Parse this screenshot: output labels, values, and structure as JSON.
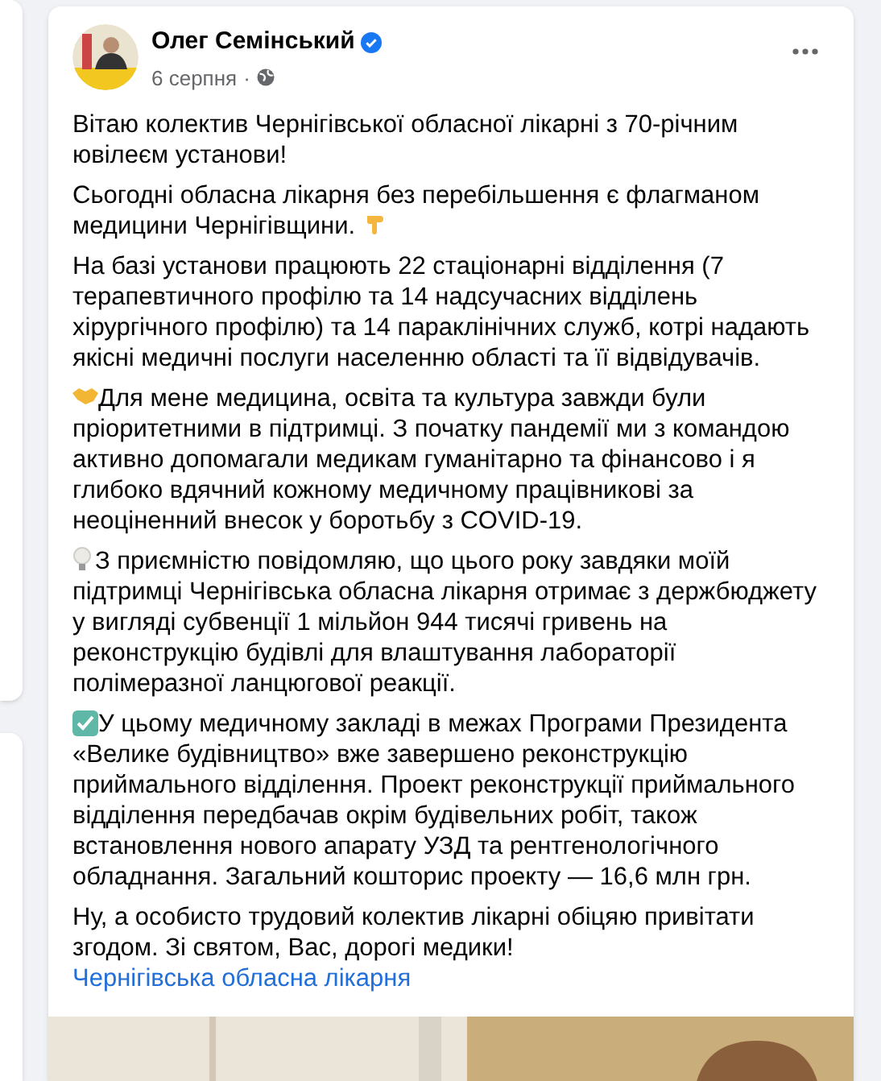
{
  "post": {
    "author": "Олег Семінський",
    "verified": true,
    "date": "6 серпня",
    "separator": "·",
    "paragraphs": [
      {
        "kind": "plain",
        "text": "Вітаю колектив Чернігівської обласної лікарні з 70-річним ювілеєм установи!"
      },
      {
        "text": "Сьогодні обласна лікарня без перебільшення є флагманом медицини Чернігівщини.",
        "kind": "pointing"
      },
      {
        "kind": "plain",
        "text": "На базі установи працюють 22 стаціонарні відділення (7 терапевтичного профілю та 14 надсучасних відділень хірургічного профілю) та 14 параклінічних служб, котрі надають якісні медичні послуги населенню області та її відвідувачів."
      },
      {
        "text": "Для мене медицина, освіта та культура завжди були пріоритетними в підтримці. З початку пандемії ми з командою активно допомагали медикам гуманітарно та фінансово і я глибоко вдячний кожному медичному працівникові за неоціненний внесок у боротьбу з COVID-19.",
        "kind": "handshake"
      },
      {
        "text": "З приємністю повідомляю, що цього року завдяки моїй підтримці Чернігівська обласна лікарня отримає з держбюджету у вигляді субвенції 1 мільйон 944 тисячі гривень на реконструкцію будівлі для влаштування лабораторії полімеразної ланцюгової реакції.",
        "kind": "bulb"
      },
      {
        "text": "У цьому медичному закладі в межах Програми Президента «Велике будівництво» вже завершено реконструкцію приймального відділення. Проект реконструкції приймального відділення передбачав окрім будівельних робіт, також встановлення нового апарату УЗД та рентгенологічного обладнання. Загальний кошторис проекту — 16,6 млн грн.",
        "kind": "check"
      },
      {
        "kind": "plain",
        "text": "Ну, а особисто трудовий колектив лікарні обіцяю привітати згодом. Зі святом, Вас, дорогі медики!",
        "link": "Чернігівська обласна лікарня"
      }
    ]
  }
}
